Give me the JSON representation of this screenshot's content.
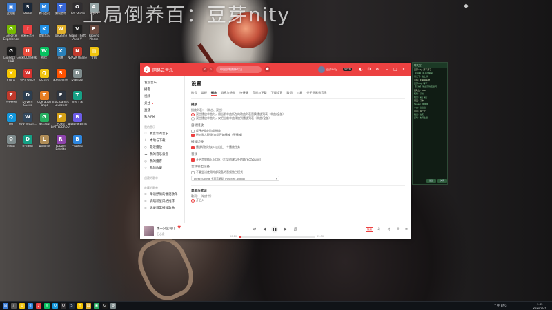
{
  "wallpaper": {
    "banner_text": "上局倒养百：豆芽nity"
  },
  "desktop_icons": [
    {
      "label": "此电脑",
      "icon": "computer-icon",
      "color": "#3a7bd5",
      "glyph": "▣"
    },
    {
      "label": "GeForce Experience",
      "icon": "geforce-icon",
      "color": "#76b900",
      "glyph": "G"
    },
    {
      "label": "Logitech G HUB",
      "icon": "logitech-icon",
      "color": "#1a1a1a",
      "glyph": "G"
    },
    {
      "label": "YY语音",
      "icon": "yy-icon",
      "color": "#f7c600",
      "glyph": "Y"
    },
    {
      "label": "中望绘图",
      "icon": "zwcad-icon",
      "color": "#c0392b",
      "glyph": "Z"
    },
    {
      "label": "QQ",
      "icon": "qq-icon",
      "color": "#1296db",
      "glyph": "Q"
    },
    {
      "label": "回收站",
      "icon": "recycle-bin-icon",
      "color": "#7f8c8d",
      "glyph": "♻"
    },
    {
      "label": "Steam",
      "icon": "steam-icon",
      "color": "#1b2838",
      "glyph": "S"
    },
    {
      "label": "网易云音乐",
      "icon": "netease-music-icon",
      "color": "#ec4141",
      "glyph": "♪"
    },
    {
      "label": "网易UU加速器",
      "icon": "uu-icon",
      "color": "#e74c3c",
      "glyph": "U"
    },
    {
      "label": "WPS Office",
      "icon": "wps-icon",
      "color": "#d6332f",
      "glyph": "W"
    },
    {
      "label": "Drive N Guess",
      "icon": "drive-icon",
      "color": "#2c3e50",
      "glyph": "D"
    },
    {
      "label": "wow_install...",
      "icon": "wow-icon",
      "color": "#34495e",
      "glyph": "W"
    },
    {
      "label": "显卡驱动",
      "icon": "driver-icon",
      "color": "#16a085",
      "glyph": "D"
    },
    {
      "label": "腾讯会议",
      "icon": "tencent-meeting-icon",
      "color": "#2e86de",
      "glyph": "M"
    },
    {
      "label": "酷狗音乐",
      "icon": "kugou-icon",
      "color": "#1f8fe5",
      "glyph": "K"
    },
    {
      "label": "微信",
      "icon": "wechat-icon",
      "color": "#07c160",
      "glyph": "W"
    },
    {
      "label": "QQ音乐",
      "icon": "qqmusic-icon",
      "color": "#f1c40f",
      "glyph": "Q"
    },
    {
      "label": "Operation Tango",
      "icon": "game-icon",
      "color": "#e67e22",
      "glyph": "T"
    },
    {
      "label": "微信游戏",
      "icon": "wechat-game-icon",
      "color": "#27ae60",
      "glyph": "G"
    },
    {
      "label": "英雄联盟",
      "icon": "lol-icon",
      "color": "#b08d57",
      "glyph": "L"
    },
    {
      "label": "腾讯游戏",
      "icon": "tencent-game-icon",
      "color": "#3867d6",
      "glyph": "T"
    },
    {
      "label": "WeGame",
      "icon": "wegame-icon",
      "color": "#e1b12c",
      "glyph": "W"
    },
    {
      "label": "迅雷",
      "icon": "thunder-icon",
      "color": "#2980b9",
      "glyph": "X"
    },
    {
      "label": "SteelSeries",
      "icon": "steelseries-icon",
      "color": "#ff5200",
      "glyph": "S"
    },
    {
      "label": "Epic Games Launcher",
      "icon": "epic-icon",
      "color": "#2f3640",
      "glyph": "E"
    },
    {
      "label": "PUBG BATTLEGROUNDS",
      "icon": "pubg-icon",
      "color": "#d4a017",
      "glyph": "P"
    },
    {
      "label": "Rubber Bandits",
      "icon": "rubber-icon",
      "color": "#8e44ad",
      "glyph": "R"
    },
    {
      "label": "OBS Studio",
      "icon": "obs-icon",
      "color": "#302e31",
      "glyph": "O"
    },
    {
      "label": "Grand Theft Auto V",
      "icon": "gta-icon",
      "color": "#222222",
      "glyph": "V"
    },
    {
      "label": "NBA2K Online",
      "icon": "nba-icon",
      "color": "#c0392b",
      "glyph": "N"
    },
    {
      "label": "DiagTool",
      "icon": "diag-icon",
      "color": "#7f8c8d",
      "glyph": "D"
    },
    {
      "label": "显卡工具",
      "icon": "gpu-tool-icon",
      "color": "#16a085",
      "glyph": "T"
    },
    {
      "label": "英雄联盟 BETA",
      "icon": "lol-beta-icon",
      "color": "#6c5ce7",
      "glyph": "B"
    },
    {
      "label": "百度网盘",
      "icon": "baidu-icon",
      "color": "#2e86de",
      "glyph": "B"
    },
    {
      "label": "Aspire",
      "icon": "aspire-icon",
      "color": "#95a5a6",
      "glyph": "A"
    },
    {
      "label": "Paper's Please",
      "icon": "papers-icon",
      "color": "#6d4c41",
      "glyph": "P"
    },
    {
      "label": "文档",
      "icon": "folder-icon",
      "color": "#f1c40f",
      "glyph": "▤"
    }
  ],
  "music_app": {
    "app_name": "网易云音乐",
    "search_placeholder": "中国说唱巅峰对决",
    "user_name": "豆芽nity",
    "vip_label": "VIP·6",
    "sidebar": [
      {
        "label": "发现音乐",
        "type": "item"
      },
      {
        "label": "播客",
        "type": "item"
      },
      {
        "label": "视频",
        "type": "item"
      },
      {
        "label": "关注",
        "type": "item",
        "dot": true
      },
      {
        "label": "直播",
        "type": "item"
      },
      {
        "label": "私人FM",
        "type": "item"
      },
      {
        "label": "我的音乐",
        "type": "section"
      },
      {
        "label": "我喜欢的音乐",
        "type": "item",
        "icon": "♡"
      },
      {
        "label": "本地与下载",
        "type": "item",
        "icon": "↓"
      },
      {
        "label": "最近播放",
        "type": "item",
        "icon": "◷"
      },
      {
        "label": "我的音乐云盘",
        "type": "item",
        "icon": "☁"
      },
      {
        "label": "我的播客",
        "type": "item",
        "icon": "◎"
      },
      {
        "label": "我的收藏",
        "type": "item",
        "icon": "☆"
      },
      {
        "label": "创建的歌单",
        "type": "section"
      },
      {
        "label": "收藏的歌单",
        "type": "section"
      },
      {
        "label": "华语抒情的催泪歌单",
        "type": "item",
        "icon": "≡"
      },
      {
        "label": "说唱新星风格推荐",
        "type": "item",
        "icon": "≡"
      },
      {
        "label": "记录日常播放歌曲",
        "type": "item",
        "icon": "≡"
      }
    ],
    "settings": {
      "title": "设置",
      "tabs": [
        "账号",
        "常规",
        "播放",
        "消息与隐私",
        "快捷键",
        "音质与下载",
        "下载设置",
        "歌词",
        "工具",
        "关于网易云音乐"
      ],
      "active_tab": "播放",
      "section_play": "播放",
      "list_label": "播放列表：（单击、双击）",
      "radio_1": "双击播放单曲时，用当前单曲所在的歌曲列表替换播放列表（单曲/全部）",
      "radio_2": "双击播放单曲时，仅把当前单曲添加到播放列表（单曲/全部）",
      "auto_label": "自动播放",
      "auto_1": "程序启动时自动播放",
      "auto_2": "进入私人FM时自动开始播放（不播放）",
      "fade_label": "播放切换",
      "fade_1": "播放切换时淡入淡出上一个播放任务",
      "device_label": "音效",
      "device_1": "开启音效插入入口区（引导创建以外的DirectSound）",
      "output_label": "音频输出设备",
      "output_1": "不要尝试使用外部设备的音频独占模式",
      "output_device": "DirectSound 主声音驱动 (Realtek Audio)",
      "section_lyrics": "桌面与歌词",
      "lyrics_label": "歌词：（软件中）",
      "lyrics_1": "开启入"
    },
    "player": {
      "song": "像一只蓝鸟儿",
      "artist": "王心凌",
      "time_elapsed": "00:10",
      "time_total": "03:50",
      "progress": 0.04,
      "quality": "极高"
    }
  },
  "chat_panel": {
    "title": "聊天室",
    "lines": [
      "豆芽nity: 开了开了",
      "【游客】进入直播间",
      "月光下: 晚上好",
      "小鱼: 主播唱首歌",
      "豆芽nity: 等下",
      "【系统】欢迎来到直播间",
      "风吹过: 666",
      "知秋: 好听",
      "阿杰: 来了来了",
      "夏天: 打卡",
      "Speed: 冲冲冲",
      "小白: 哈哈哈",
      "某某: 蹲一个",
      "路过: 晚安",
      "鹿鸣: 支持主播"
    ],
    "btn_send": "发送",
    "btn_close": "关闭"
  },
  "taskbar": {
    "apps": [
      "start-icon",
      "search-icon",
      "file-explorer-icon",
      "edge-icon",
      "netease-music-icon",
      "wechat-icon",
      "qq-icon",
      "obs-icon",
      "steam-icon",
      "yy-icon",
      "folder-icon",
      "chrome-icon",
      "logitech-icon",
      "settings-icon"
    ],
    "app_colors": [
      "#3a7bd5",
      "#555",
      "#f1c40f",
      "#2e86de",
      "#ec4141",
      "#07c160",
      "#1296db",
      "#302e31",
      "#1b2838",
      "#f7c600",
      "#e1b12c",
      "#27ae60",
      "#1a1a1a",
      "#7f8c8d"
    ],
    "tray_text": "^ 中 ENG",
    "time": "9:35",
    "date": "2021/7/29"
  }
}
